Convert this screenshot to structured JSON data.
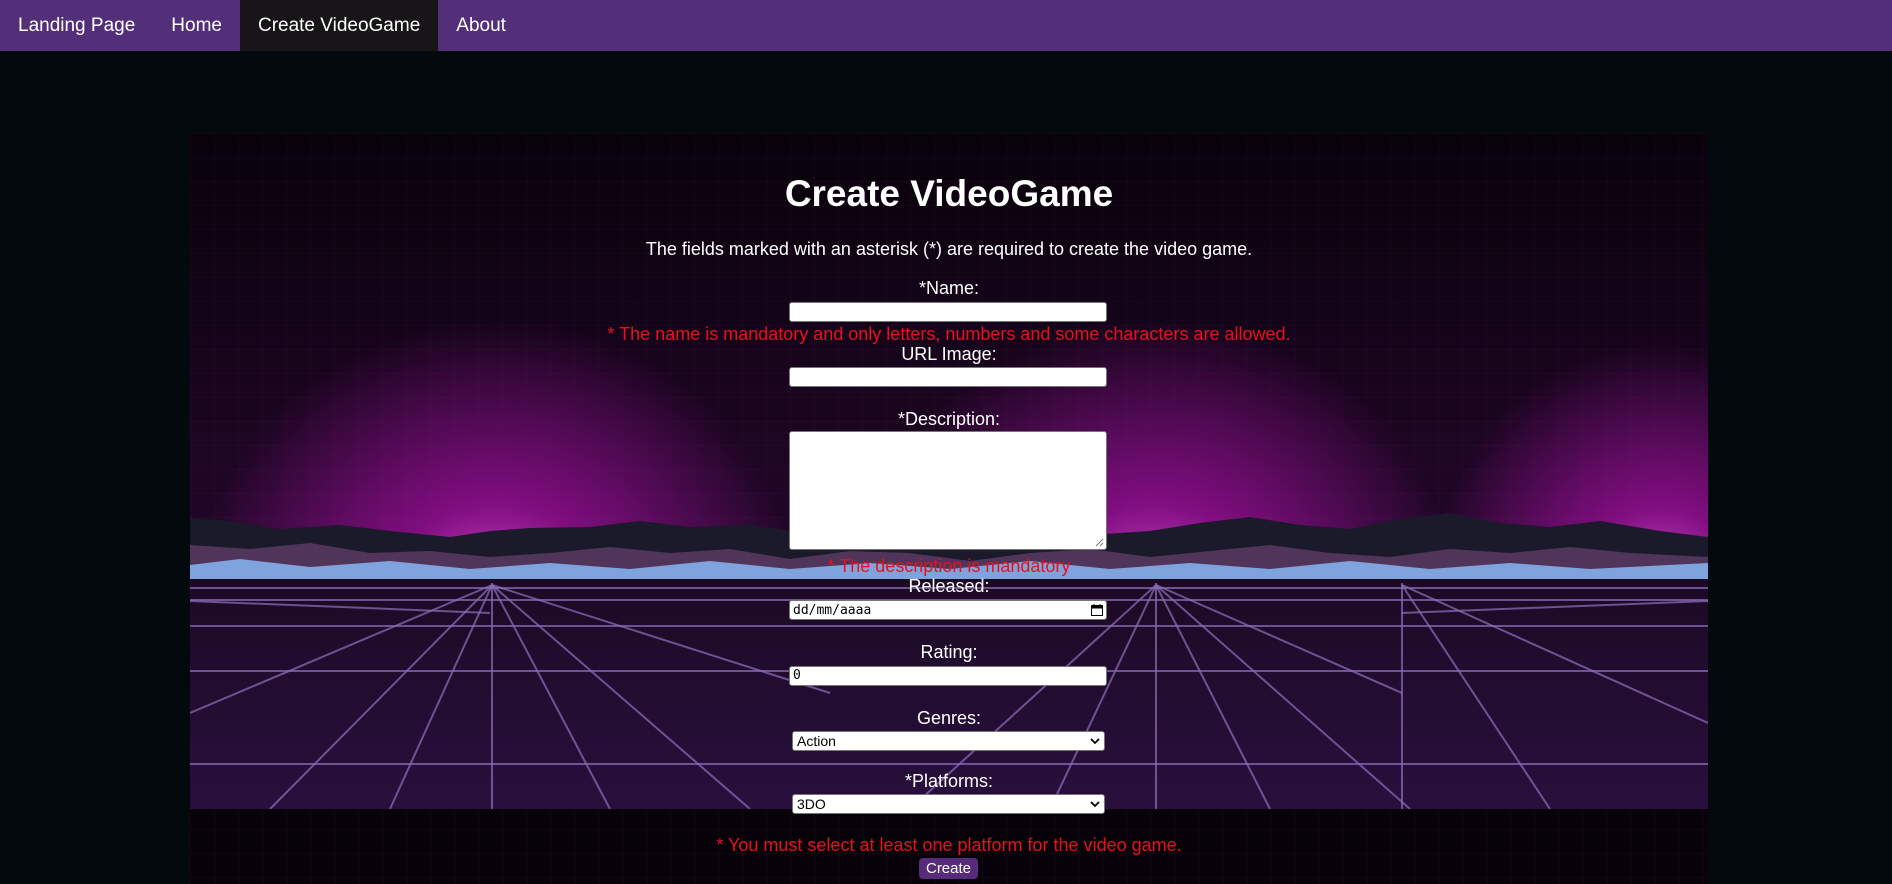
{
  "nav": {
    "items": [
      {
        "label": "Landing Page",
        "active": false
      },
      {
        "label": "Home",
        "active": false
      },
      {
        "label": "Create VideoGame",
        "active": true
      },
      {
        "label": "About",
        "active": false
      }
    ]
  },
  "form": {
    "title": "Create VideoGame",
    "subtitle": "The fields marked with an asterisk (*) are required to create the video game.",
    "name": {
      "label": "*Name:",
      "value": "",
      "error": "* The name is mandatory and only letters, numbers and some characters are allowed."
    },
    "image": {
      "label": "URL Image:",
      "value": ""
    },
    "description": {
      "label": "*Description:",
      "value": "",
      "error": "* The description is mandatory"
    },
    "released": {
      "label": "Released:",
      "placeholder": "dd/mm/aaaa"
    },
    "rating": {
      "label": "Rating:",
      "value": "0"
    },
    "genres": {
      "label": "Genres:",
      "selected": "Action"
    },
    "platforms": {
      "label": "*Platforms:",
      "selected": "3DO",
      "error": "* You must select at least one platform for the video game."
    },
    "submit_label": "Create"
  },
  "colors": {
    "nav_bg": "#522f78",
    "nav_active_bg": "#171517",
    "page_bg": "#03090d",
    "error_text": "#e8111b",
    "button_bg": "#572b79",
    "glow": "#a0109e"
  },
  "icons": {
    "released": "calendar-icon",
    "select": "chevron-down-icon",
    "textarea": "resize-grip-icon"
  }
}
